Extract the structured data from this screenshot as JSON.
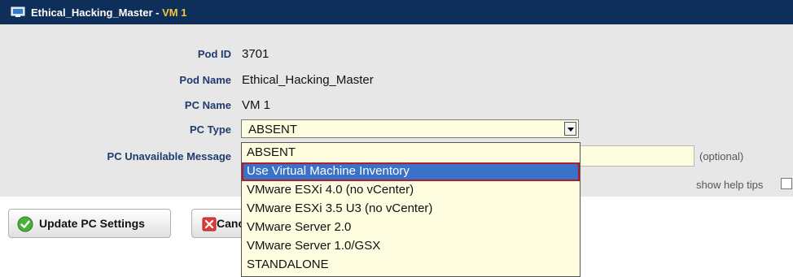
{
  "window": {
    "title_main": "Ethical_Hacking_Master - ",
    "title_vm": "VM 1",
    "icon": "computer-icon"
  },
  "form": {
    "pod_id": {
      "label": "Pod ID",
      "value": "3701"
    },
    "pod_name": {
      "label": "Pod Name",
      "value": "Ethical_Hacking_Master"
    },
    "pc_name": {
      "label": "PC Name",
      "value": "VM 1"
    },
    "pc_type": {
      "label": "PC Type",
      "value": "ABSENT",
      "options": [
        "ABSENT",
        "Use Virtual Machine Inventory",
        "VMware ESXi 4.0 (no vCenter)",
        "VMware ESXi 3.5 U3 (no vCenter)",
        "VMware Server 2.0",
        "VMware Server 1.0/GSX",
        "STANDALONE"
      ],
      "highlighted_index": 1
    },
    "pc_unavailable_message": {
      "label": "PC Unavailable Message",
      "value": "",
      "hint": "(optional)"
    },
    "help_tips_label": "show help tips"
  },
  "buttons": {
    "update": {
      "label": "Update PC Settings",
      "icon": "check-icon"
    },
    "cancel": {
      "label": "Canc",
      "icon": "x-icon"
    }
  },
  "colors": {
    "titlebar": "#0f2f5b",
    "title_accent": "#f4c542",
    "label": "#1f3b6f",
    "field_bg": "#fffde0",
    "highlight": "#3b72c9",
    "highlight_outline": "#b01e2e"
  }
}
